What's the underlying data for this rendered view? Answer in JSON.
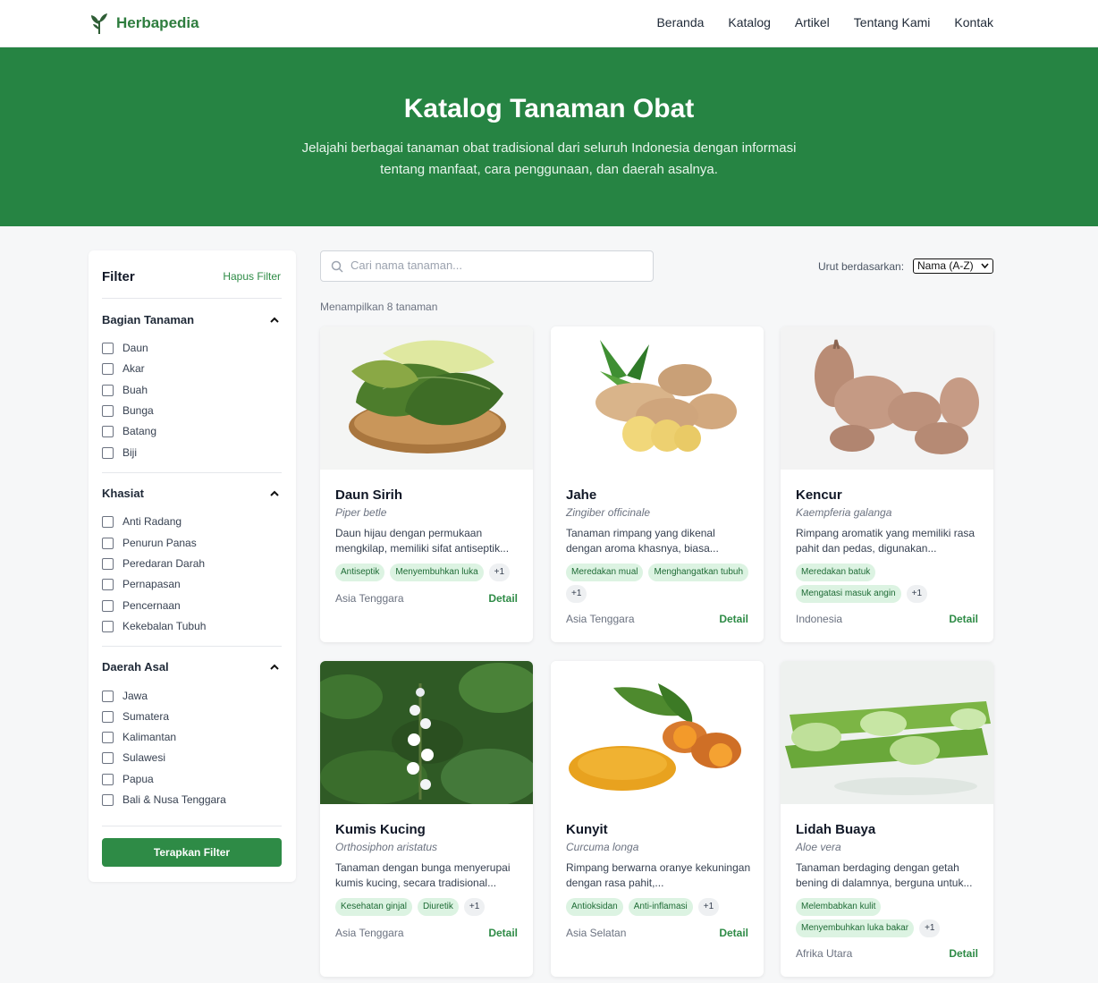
{
  "brand": {
    "name": "Herbapedia"
  },
  "nav": {
    "items": [
      "Beranda",
      "Katalog",
      "Artikel",
      "Tentang Kami",
      "Kontak"
    ]
  },
  "hero": {
    "title": "Katalog Tanaman Obat",
    "subtitle": "Jelajahi berbagai tanaman obat tradisional dari seluruh Indonesia dengan informasi tentang manfaat, cara penggunaan, dan daerah asalnya."
  },
  "filter": {
    "title": "Filter",
    "clear_label": "Hapus Filter",
    "sections": [
      {
        "title": "Bagian Tanaman",
        "options": [
          "Daun",
          "Akar",
          "Buah",
          "Bunga",
          "Batang",
          "Biji"
        ]
      },
      {
        "title": "Khasiat",
        "options": [
          "Anti Radang",
          "Penurun Panas",
          "Peredaran Darah",
          "Pernapasan",
          "Pencernaan",
          "Kekebalan Tubuh"
        ]
      },
      {
        "title": "Daerah Asal",
        "options": [
          "Jawa",
          "Sumatera",
          "Kalimantan",
          "Sulawesi",
          "Papua",
          "Bali & Nusa Tenggara"
        ]
      }
    ],
    "apply_label": "Terapkan Filter"
  },
  "search": {
    "placeholder": "Cari nama tanaman..."
  },
  "sort": {
    "label": "Urut berdasarkan:",
    "selected": "Nama (A-Z)"
  },
  "results": {
    "count_text": "Menampilkan 8 tanaman"
  },
  "plants": [
    {
      "name": "Daun Sirih",
      "latin": "Piper betle",
      "desc": "Daun hijau dengan permukaan mengkilap, memiliki sifat antiseptik...",
      "tags": [
        "Antiseptik",
        "Menyembuhkan luka"
      ],
      "more": "+1",
      "origin": "Asia Tenggara",
      "detail": "Detail",
      "image": "betel-leaf"
    },
    {
      "name": "Jahe",
      "latin": "Zingiber officinale",
      "desc": "Tanaman rimpang yang dikenal dengan aroma khasnya, biasa...",
      "tags": [
        "Meredakan mual",
        "Menghangatkan tubuh"
      ],
      "more": "+1",
      "origin": "Asia Tenggara",
      "detail": "Detail",
      "image": "ginger-root"
    },
    {
      "name": "Kencur",
      "latin": "Kaempferia galanga",
      "desc": "Rimpang aromatik yang memiliki rasa pahit dan pedas, digunakan...",
      "tags": [
        "Meredakan batuk",
        "Mengatasi masuk angin"
      ],
      "more": "+1",
      "origin": "Indonesia",
      "detail": "Detail",
      "image": "galangal-root"
    },
    {
      "name": "Kumis Kucing",
      "latin": "Orthosiphon aristatus",
      "desc": "Tanaman dengan bunga menyerupai kumis kucing, secara tradisional...",
      "tags": [
        "Kesehatan ginjal",
        "Diuretik"
      ],
      "more": "+1",
      "origin": "Asia Tenggara",
      "detail": "Detail",
      "image": "cat-whiskers-flower"
    },
    {
      "name": "Kunyit",
      "latin": "Curcuma longa",
      "desc": "Rimpang berwarna oranye kekuningan dengan rasa pahit,...",
      "tags": [
        "Antioksidan",
        "Anti-inflamasi"
      ],
      "more": "+1",
      "origin": "Asia Selatan",
      "detail": "Detail",
      "image": "turmeric"
    },
    {
      "name": "Lidah Buaya",
      "latin": "Aloe vera",
      "desc": "Tanaman berdaging dengan getah bening di dalamnya, berguna untuk...",
      "tags": [
        "Melembabkan kulit",
        "Menyembuhkan luka bakar"
      ],
      "more": "+1",
      "origin": "Afrika Utara",
      "detail": "Detail",
      "image": "aloe-vera"
    }
  ],
  "colors": {
    "primary": "#268443",
    "accent": "#2e8b46",
    "tag_bg": "#dcf3e2"
  }
}
